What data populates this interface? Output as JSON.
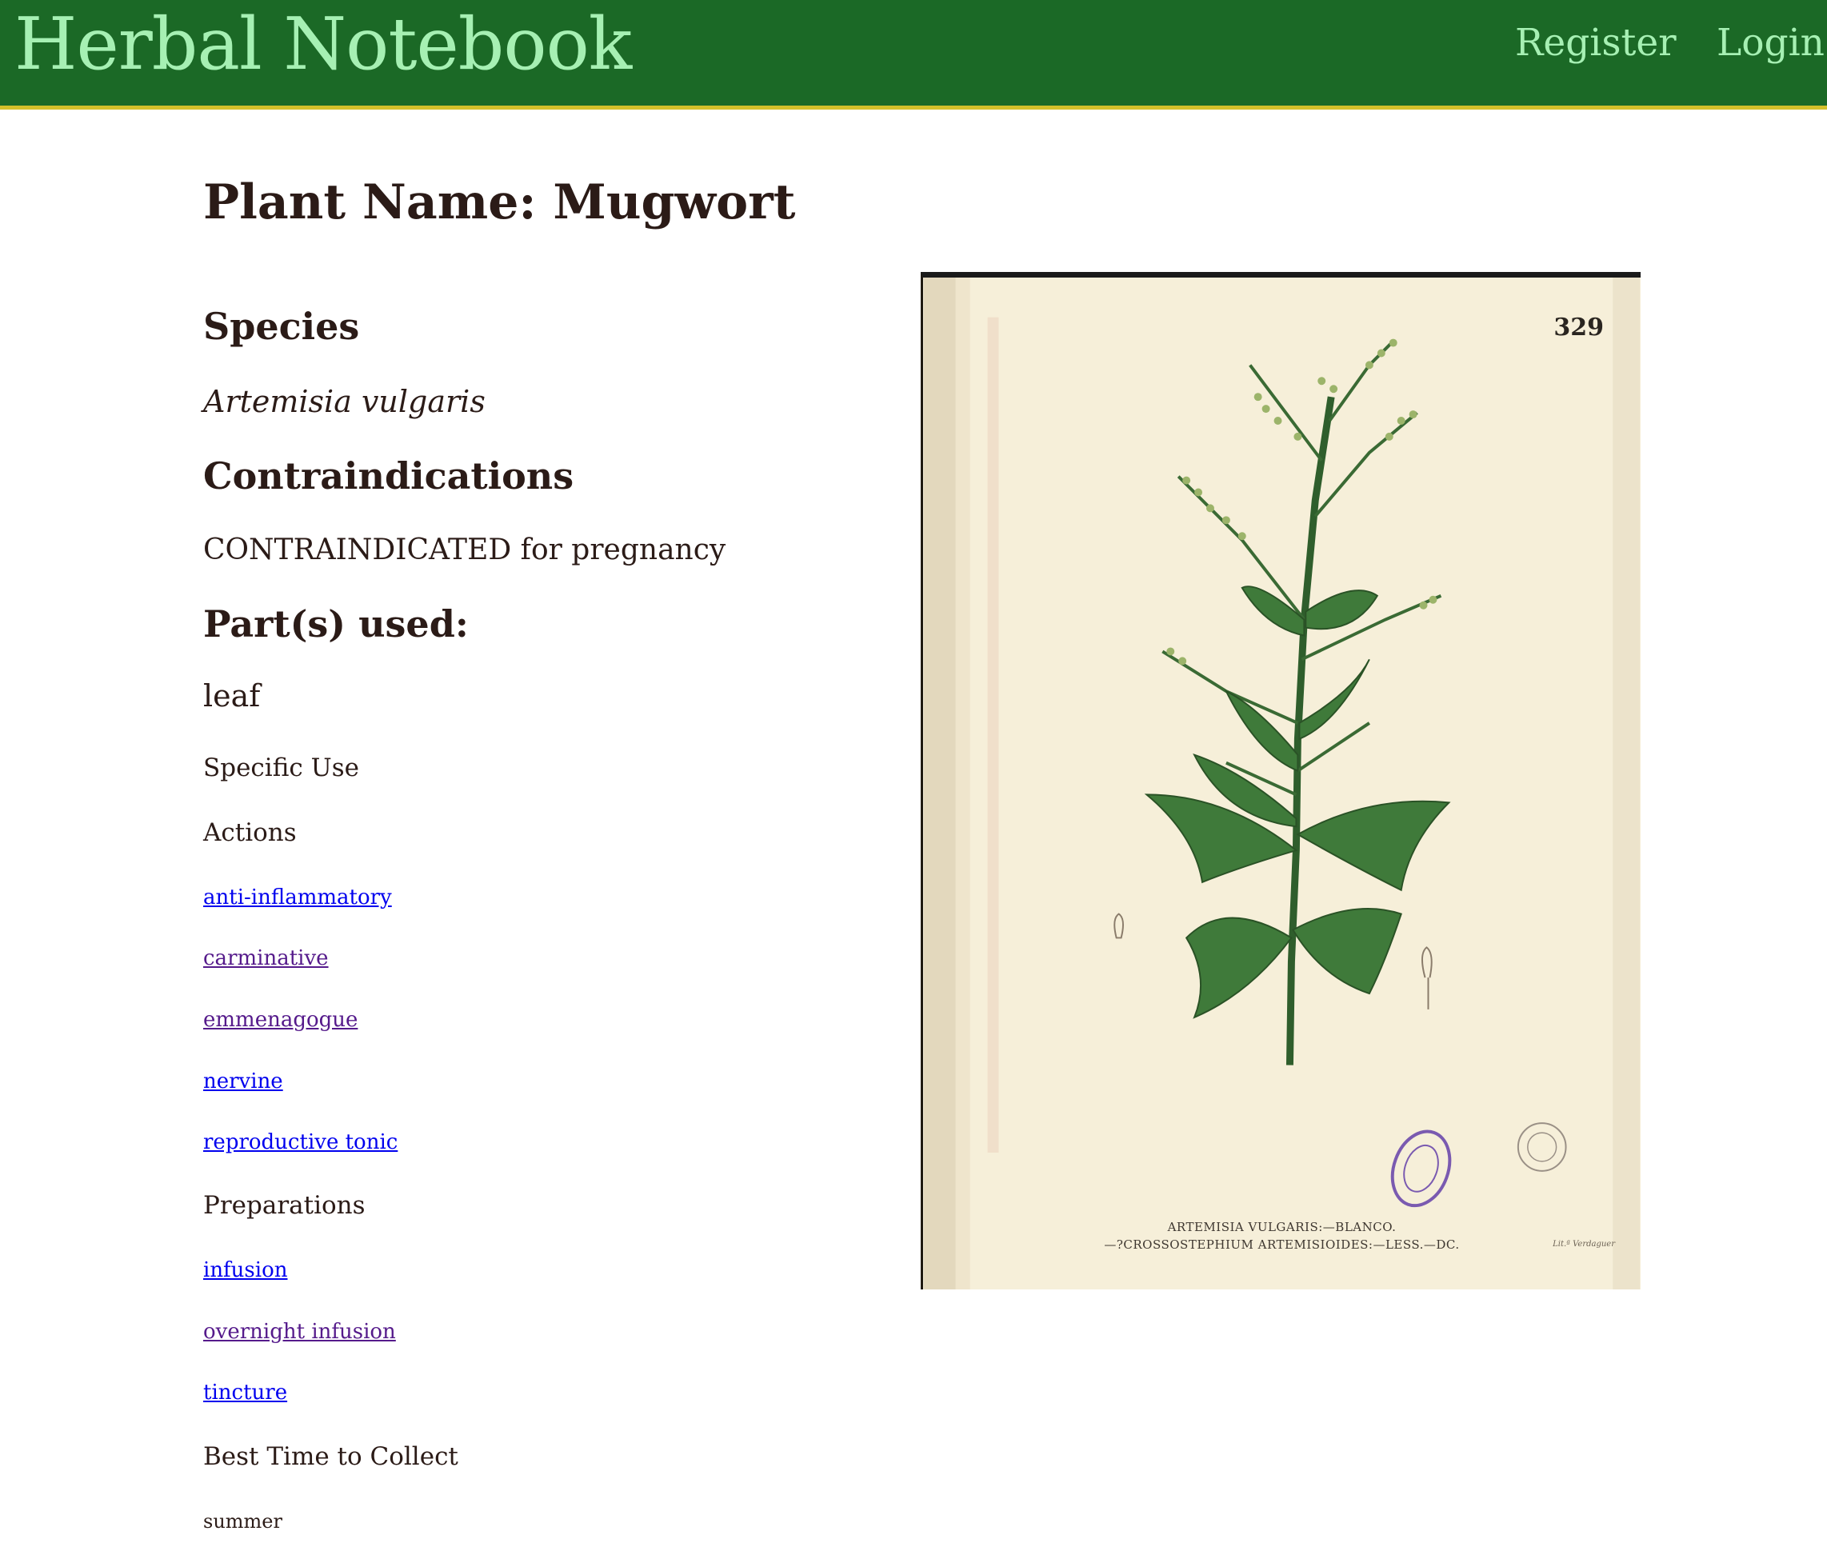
{
  "header": {
    "brand": "Herbal Notebook",
    "nav": {
      "register": "Register",
      "login": "Login"
    }
  },
  "plant": {
    "title": "Plant Name: Mugwort",
    "species_heading": "Species",
    "species": "Artemisia vulgaris",
    "contra_heading": "Contraindications",
    "contraindications": "CONTRAINDICATED for pregnancy",
    "parts_heading": "Part(s) used:",
    "parts": "leaf",
    "specific_use_heading": "Specific Use",
    "actions_heading": "Actions",
    "actions": [
      {
        "label": "anti-inflammatory",
        "visited": false
      },
      {
        "label": "carminative",
        "visited": true
      },
      {
        "label": "emmenagogue",
        "visited": true
      },
      {
        "label": "nervine",
        "visited": false
      },
      {
        "label": "reproductive tonic",
        "visited": false
      }
    ],
    "preparations_heading": "Preparations",
    "preparations": [
      {
        "label": "infusion",
        "visited": false
      },
      {
        "label": "overnight infusion",
        "visited": true
      },
      {
        "label": "tincture",
        "visited": false
      }
    ],
    "best_time_heading": "Best Time to Collect",
    "best_time": "summer"
  },
  "plate": {
    "number": "329",
    "caption_line1": "ARTEMISIA VULGARIS:—BLANCO.",
    "caption_line2": "—?CROSSOSTEPHIUM ARTEMISIOIDES:—LESS.—DC.",
    "credit": "Lit.ª Verdaguer",
    "colors": {
      "paper": "#f6efd9",
      "leaf": "#3f7a3a",
      "stamp": "#7a5ab0"
    }
  }
}
